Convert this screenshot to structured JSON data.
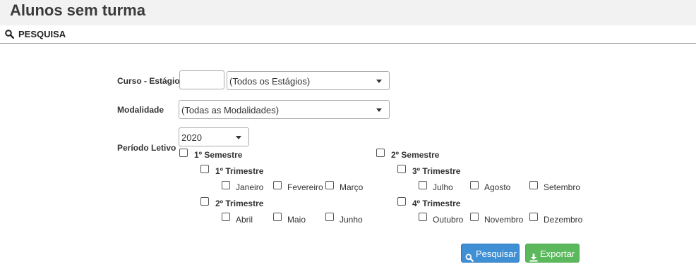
{
  "page": {
    "title": "Alunos sem turma"
  },
  "panel": {
    "title": "PESQUISA"
  },
  "form": {
    "curso_label": "Curso - Estágio",
    "curso_code_value": "",
    "estagio_select": "(Todos os Estágios)",
    "modalidade_label": "Modalidade",
    "modalidade_select": "(Todas as Modalidades)",
    "periodo_label": "Período Letivo",
    "ano_select": "2020"
  },
  "periods": {
    "sem1": "1º Semestre",
    "sem2": "2º Semestre",
    "tri1": "1º Trimestre",
    "tri2": "2º Trimestre",
    "tri3": "3º Trimestre",
    "tri4": "4º Trimestre",
    "months": [
      "Janeiro",
      "Fevereiro",
      "Março",
      "Abril",
      "Maio",
      "Junho",
      "Julho",
      "Agosto",
      "Setembro",
      "Outubro",
      "Novembro",
      "Dezembro"
    ]
  },
  "buttons": {
    "search": "Pesquisar",
    "export": "Exportar"
  },
  "colors": {
    "search_button": "#3f8fd4",
    "export_button": "#5cb85c"
  },
  "icons": {
    "search": "search-icon",
    "export": "download-icon",
    "panel": "search-icon"
  }
}
